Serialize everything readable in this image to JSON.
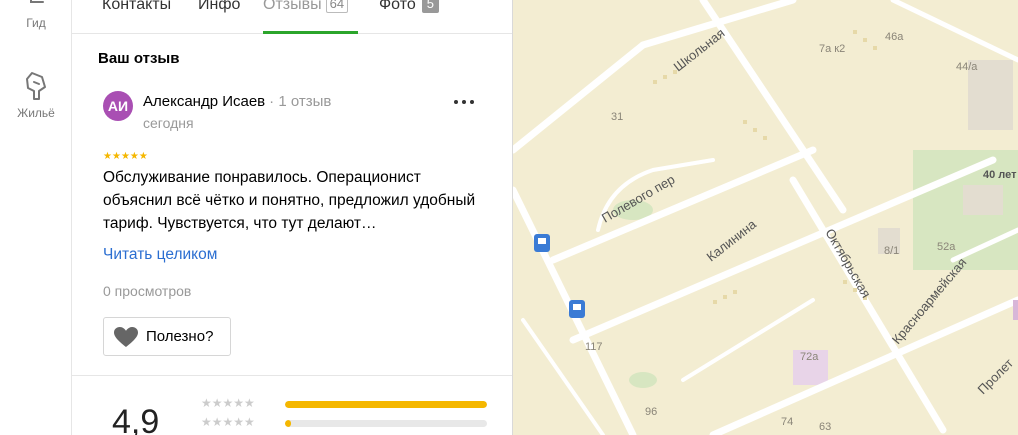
{
  "rail": {
    "guide_label": "Гид",
    "housing_label": "Жильё"
  },
  "tabs": {
    "contacts": "Контакты",
    "info": "Инфо",
    "reviews": "Отзывы",
    "reviews_count": "64",
    "photo": "Фото",
    "photo_count": "5"
  },
  "review_section": {
    "title": "Ваш отзыв"
  },
  "review": {
    "avatar_initials": "АИ",
    "author": "Александр Исаев",
    "author_reviews": "· 1 отзыв",
    "date": "сегодня",
    "rating": 5,
    "text": "Обслуживание понравилось. Операционист объяснил всё чётко и понятно, предложил удобный тариф. Чувствуется, что тут делают…",
    "read_more": "Читать целиком",
    "views": "0 просмотров",
    "useful_label": "Полезно?"
  },
  "summary": {
    "rating": "4,9",
    "distribution": [
      {
        "stars": 5,
        "fraction": 1.0
      },
      {
        "stars": 4,
        "fraction": 0.03
      }
    ]
  },
  "map": {
    "streets": [
      "Школьная",
      "Полевого пер",
      "Калинина",
      "Октябрьская",
      "Красноармейская",
      "Пролет"
    ],
    "labels": [
      "46а",
      "7а к2",
      "44/а",
      "40 лет",
      "31",
      "8/1",
      "52а",
      "117",
      "72а",
      "96",
      "74",
      "63"
    ],
    "colors": {
      "land": "#f3edd2",
      "road": "#ffffff",
      "park": "#d7e6c1",
      "building": "#e3ddd0"
    }
  }
}
